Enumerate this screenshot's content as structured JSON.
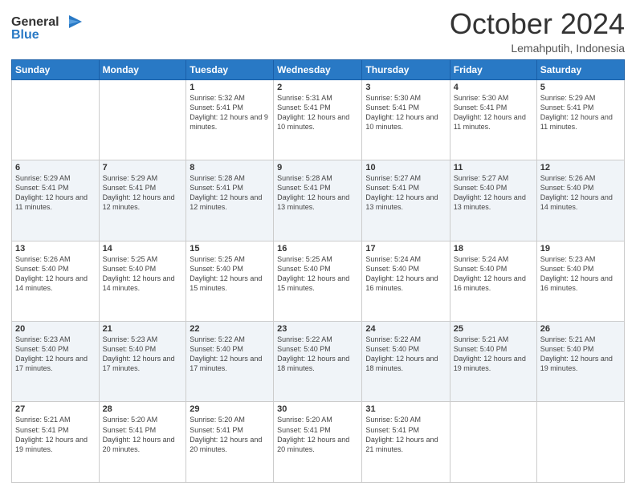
{
  "logo": {
    "line1": "General",
    "line2": "Blue"
  },
  "header": {
    "month": "October 2024",
    "location": "Lemahputih, Indonesia"
  },
  "weekdays": [
    "Sunday",
    "Monday",
    "Tuesday",
    "Wednesday",
    "Thursday",
    "Friday",
    "Saturday"
  ],
  "weeks": [
    [
      {
        "day": "",
        "info": ""
      },
      {
        "day": "",
        "info": ""
      },
      {
        "day": "1",
        "info": "Sunrise: 5:32 AM\nSunset: 5:41 PM\nDaylight: 12 hours and 9 minutes."
      },
      {
        "day": "2",
        "info": "Sunrise: 5:31 AM\nSunset: 5:41 PM\nDaylight: 12 hours and 10 minutes."
      },
      {
        "day": "3",
        "info": "Sunrise: 5:30 AM\nSunset: 5:41 PM\nDaylight: 12 hours and 10 minutes."
      },
      {
        "day": "4",
        "info": "Sunrise: 5:30 AM\nSunset: 5:41 PM\nDaylight: 12 hours and 11 minutes."
      },
      {
        "day": "5",
        "info": "Sunrise: 5:29 AM\nSunset: 5:41 PM\nDaylight: 12 hours and 11 minutes."
      }
    ],
    [
      {
        "day": "6",
        "info": "Sunrise: 5:29 AM\nSunset: 5:41 PM\nDaylight: 12 hours and 11 minutes."
      },
      {
        "day": "7",
        "info": "Sunrise: 5:29 AM\nSunset: 5:41 PM\nDaylight: 12 hours and 12 minutes."
      },
      {
        "day": "8",
        "info": "Sunrise: 5:28 AM\nSunset: 5:41 PM\nDaylight: 12 hours and 12 minutes."
      },
      {
        "day": "9",
        "info": "Sunrise: 5:28 AM\nSunset: 5:41 PM\nDaylight: 12 hours and 13 minutes."
      },
      {
        "day": "10",
        "info": "Sunrise: 5:27 AM\nSunset: 5:41 PM\nDaylight: 12 hours and 13 minutes."
      },
      {
        "day": "11",
        "info": "Sunrise: 5:27 AM\nSunset: 5:40 PM\nDaylight: 12 hours and 13 minutes."
      },
      {
        "day": "12",
        "info": "Sunrise: 5:26 AM\nSunset: 5:40 PM\nDaylight: 12 hours and 14 minutes."
      }
    ],
    [
      {
        "day": "13",
        "info": "Sunrise: 5:26 AM\nSunset: 5:40 PM\nDaylight: 12 hours and 14 minutes."
      },
      {
        "day": "14",
        "info": "Sunrise: 5:25 AM\nSunset: 5:40 PM\nDaylight: 12 hours and 14 minutes."
      },
      {
        "day": "15",
        "info": "Sunrise: 5:25 AM\nSunset: 5:40 PM\nDaylight: 12 hours and 15 minutes."
      },
      {
        "day": "16",
        "info": "Sunrise: 5:25 AM\nSunset: 5:40 PM\nDaylight: 12 hours and 15 minutes."
      },
      {
        "day": "17",
        "info": "Sunrise: 5:24 AM\nSunset: 5:40 PM\nDaylight: 12 hours and 16 minutes."
      },
      {
        "day": "18",
        "info": "Sunrise: 5:24 AM\nSunset: 5:40 PM\nDaylight: 12 hours and 16 minutes."
      },
      {
        "day": "19",
        "info": "Sunrise: 5:23 AM\nSunset: 5:40 PM\nDaylight: 12 hours and 16 minutes."
      }
    ],
    [
      {
        "day": "20",
        "info": "Sunrise: 5:23 AM\nSunset: 5:40 PM\nDaylight: 12 hours and 17 minutes."
      },
      {
        "day": "21",
        "info": "Sunrise: 5:23 AM\nSunset: 5:40 PM\nDaylight: 12 hours and 17 minutes."
      },
      {
        "day": "22",
        "info": "Sunrise: 5:22 AM\nSunset: 5:40 PM\nDaylight: 12 hours and 17 minutes."
      },
      {
        "day": "23",
        "info": "Sunrise: 5:22 AM\nSunset: 5:40 PM\nDaylight: 12 hours and 18 minutes."
      },
      {
        "day": "24",
        "info": "Sunrise: 5:22 AM\nSunset: 5:40 PM\nDaylight: 12 hours and 18 minutes."
      },
      {
        "day": "25",
        "info": "Sunrise: 5:21 AM\nSunset: 5:40 PM\nDaylight: 12 hours and 19 minutes."
      },
      {
        "day": "26",
        "info": "Sunrise: 5:21 AM\nSunset: 5:40 PM\nDaylight: 12 hours and 19 minutes."
      }
    ],
    [
      {
        "day": "27",
        "info": "Sunrise: 5:21 AM\nSunset: 5:41 PM\nDaylight: 12 hours and 19 minutes."
      },
      {
        "day": "28",
        "info": "Sunrise: 5:20 AM\nSunset: 5:41 PM\nDaylight: 12 hours and 20 minutes."
      },
      {
        "day": "29",
        "info": "Sunrise: 5:20 AM\nSunset: 5:41 PM\nDaylight: 12 hours and 20 minutes."
      },
      {
        "day": "30",
        "info": "Sunrise: 5:20 AM\nSunset: 5:41 PM\nDaylight: 12 hours and 20 minutes."
      },
      {
        "day": "31",
        "info": "Sunrise: 5:20 AM\nSunset: 5:41 PM\nDaylight: 12 hours and 21 minutes."
      },
      {
        "day": "",
        "info": ""
      },
      {
        "day": "",
        "info": ""
      }
    ]
  ]
}
